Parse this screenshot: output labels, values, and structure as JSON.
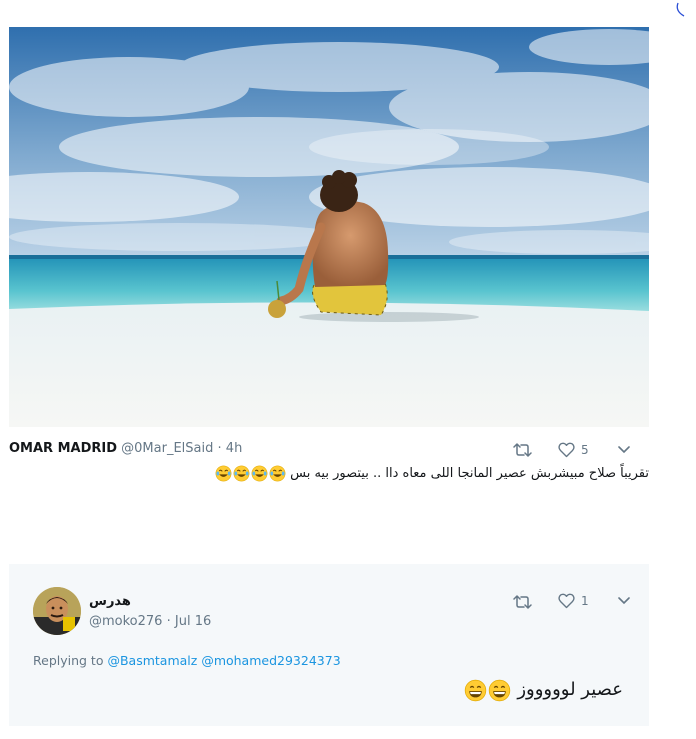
{
  "tweet": {
    "author_name": "OMAR MADRID",
    "handle": "@0Mar_ElSaid",
    "separator": "·",
    "time": "4h",
    "text": "تقريباً صلاح مبيشربش عصير المانجا اللى معاه داا .. بيتصور بيه بس",
    "emojis": [
      "joy-emoji",
      "joy-emoji",
      "joy-emoji",
      "joy-emoji"
    ],
    "retweet_count": "",
    "like_count": "5"
  },
  "reply": {
    "author_name": "هدرس",
    "handle": "@moko276",
    "separator": "·",
    "date": "Jul 16",
    "replying_to_label": "Replying to",
    "replying_to": [
      "@Basmtamalz",
      "@mohamed29324373"
    ],
    "text": "عصير لوووووز",
    "emojis": [
      "grin-emoji",
      "grin-emoji"
    ],
    "retweet_count": "",
    "like_count": "1"
  },
  "colors": {
    "link": "#1b95e0",
    "muted": "#657786",
    "reply_background": "#f5f8fa"
  }
}
